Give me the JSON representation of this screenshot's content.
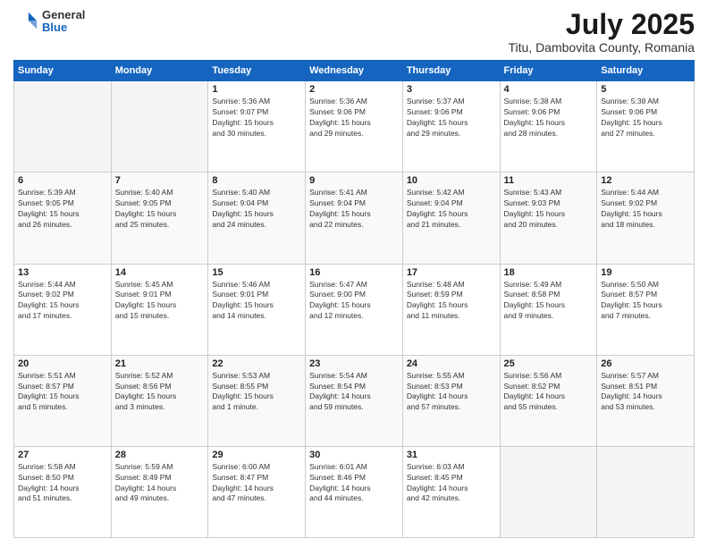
{
  "header": {
    "logo_general": "General",
    "logo_blue": "Blue",
    "title": "July 2025",
    "subtitle": "Titu, Dambovita County, Romania"
  },
  "calendar": {
    "days_of_week": [
      "Sunday",
      "Monday",
      "Tuesday",
      "Wednesday",
      "Thursday",
      "Friday",
      "Saturday"
    ],
    "weeks": [
      [
        {
          "day": "",
          "info": ""
        },
        {
          "day": "",
          "info": ""
        },
        {
          "day": "1",
          "info": "Sunrise: 5:36 AM\nSunset: 9:07 PM\nDaylight: 15 hours\nand 30 minutes."
        },
        {
          "day": "2",
          "info": "Sunrise: 5:36 AM\nSunset: 9:06 PM\nDaylight: 15 hours\nand 29 minutes."
        },
        {
          "day": "3",
          "info": "Sunrise: 5:37 AM\nSunset: 9:06 PM\nDaylight: 15 hours\nand 29 minutes."
        },
        {
          "day": "4",
          "info": "Sunrise: 5:38 AM\nSunset: 9:06 PM\nDaylight: 15 hours\nand 28 minutes."
        },
        {
          "day": "5",
          "info": "Sunrise: 5:38 AM\nSunset: 9:06 PM\nDaylight: 15 hours\nand 27 minutes."
        }
      ],
      [
        {
          "day": "6",
          "info": "Sunrise: 5:39 AM\nSunset: 9:05 PM\nDaylight: 15 hours\nand 26 minutes."
        },
        {
          "day": "7",
          "info": "Sunrise: 5:40 AM\nSunset: 9:05 PM\nDaylight: 15 hours\nand 25 minutes."
        },
        {
          "day": "8",
          "info": "Sunrise: 5:40 AM\nSunset: 9:04 PM\nDaylight: 15 hours\nand 24 minutes."
        },
        {
          "day": "9",
          "info": "Sunrise: 5:41 AM\nSunset: 9:04 PM\nDaylight: 15 hours\nand 22 minutes."
        },
        {
          "day": "10",
          "info": "Sunrise: 5:42 AM\nSunset: 9:04 PM\nDaylight: 15 hours\nand 21 minutes."
        },
        {
          "day": "11",
          "info": "Sunrise: 5:43 AM\nSunset: 9:03 PM\nDaylight: 15 hours\nand 20 minutes."
        },
        {
          "day": "12",
          "info": "Sunrise: 5:44 AM\nSunset: 9:02 PM\nDaylight: 15 hours\nand 18 minutes."
        }
      ],
      [
        {
          "day": "13",
          "info": "Sunrise: 5:44 AM\nSunset: 9:02 PM\nDaylight: 15 hours\nand 17 minutes."
        },
        {
          "day": "14",
          "info": "Sunrise: 5:45 AM\nSunset: 9:01 PM\nDaylight: 15 hours\nand 15 minutes."
        },
        {
          "day": "15",
          "info": "Sunrise: 5:46 AM\nSunset: 9:01 PM\nDaylight: 15 hours\nand 14 minutes."
        },
        {
          "day": "16",
          "info": "Sunrise: 5:47 AM\nSunset: 9:00 PM\nDaylight: 15 hours\nand 12 minutes."
        },
        {
          "day": "17",
          "info": "Sunrise: 5:48 AM\nSunset: 8:59 PM\nDaylight: 15 hours\nand 11 minutes."
        },
        {
          "day": "18",
          "info": "Sunrise: 5:49 AM\nSunset: 8:58 PM\nDaylight: 15 hours\nand 9 minutes."
        },
        {
          "day": "19",
          "info": "Sunrise: 5:50 AM\nSunset: 8:57 PM\nDaylight: 15 hours\nand 7 minutes."
        }
      ],
      [
        {
          "day": "20",
          "info": "Sunrise: 5:51 AM\nSunset: 8:57 PM\nDaylight: 15 hours\nand 5 minutes."
        },
        {
          "day": "21",
          "info": "Sunrise: 5:52 AM\nSunset: 8:56 PM\nDaylight: 15 hours\nand 3 minutes."
        },
        {
          "day": "22",
          "info": "Sunrise: 5:53 AM\nSunset: 8:55 PM\nDaylight: 15 hours\nand 1 minute."
        },
        {
          "day": "23",
          "info": "Sunrise: 5:54 AM\nSunset: 8:54 PM\nDaylight: 14 hours\nand 59 minutes."
        },
        {
          "day": "24",
          "info": "Sunrise: 5:55 AM\nSunset: 8:53 PM\nDaylight: 14 hours\nand 57 minutes."
        },
        {
          "day": "25",
          "info": "Sunrise: 5:56 AM\nSunset: 8:52 PM\nDaylight: 14 hours\nand 55 minutes."
        },
        {
          "day": "26",
          "info": "Sunrise: 5:57 AM\nSunset: 8:51 PM\nDaylight: 14 hours\nand 53 minutes."
        }
      ],
      [
        {
          "day": "27",
          "info": "Sunrise: 5:58 AM\nSunset: 8:50 PM\nDaylight: 14 hours\nand 51 minutes."
        },
        {
          "day": "28",
          "info": "Sunrise: 5:59 AM\nSunset: 8:49 PM\nDaylight: 14 hours\nand 49 minutes."
        },
        {
          "day": "29",
          "info": "Sunrise: 6:00 AM\nSunset: 8:47 PM\nDaylight: 14 hours\nand 47 minutes."
        },
        {
          "day": "30",
          "info": "Sunrise: 6:01 AM\nSunset: 8:46 PM\nDaylight: 14 hours\nand 44 minutes."
        },
        {
          "day": "31",
          "info": "Sunrise: 6:03 AM\nSunset: 8:45 PM\nDaylight: 14 hours\nand 42 minutes."
        },
        {
          "day": "",
          "info": ""
        },
        {
          "day": "",
          "info": ""
        }
      ]
    ]
  }
}
